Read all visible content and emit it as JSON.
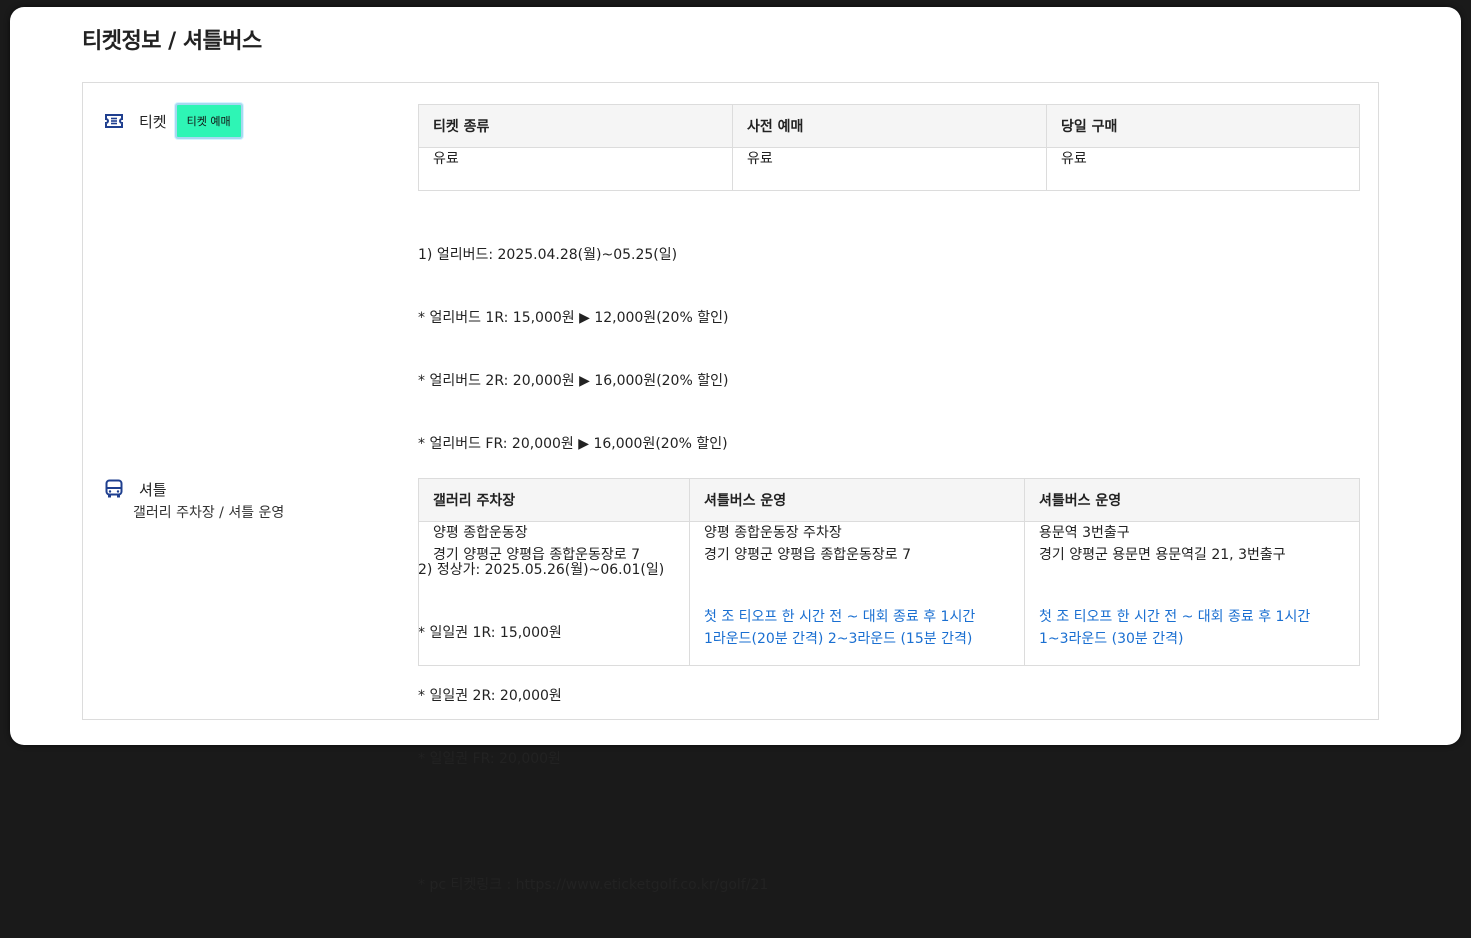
{
  "page": {
    "title": "티켓정보 / 셔틀버스"
  },
  "ticket": {
    "label": "티켓",
    "buy_button": "티켓 예매",
    "table": {
      "headers": [
        "티켓 종류",
        "사전 예매",
        "당일 구매"
      ],
      "row": [
        "유료",
        "유료",
        "유료"
      ]
    },
    "notes": [
      "1) 얼리버드: 2025.04.28(월)~05.25(일)",
      "* 얼리버드 1R: 15,000원 ▶ 12,000원(20% 할인)",
      "* 얼리버드 2R: 20,000원 ▶ 16,000원(20% 할인)",
      "* 얼리버드 FR: 20,000원 ▶ 16,000원(20% 할인)",
      "",
      "2) 정상가: 2025.05.26(월)~06.01(일)",
      "* 일일권 1R: 15,000원",
      "* 일일권 2R: 20,000원",
      "* 일일권 FR: 20,000원",
      "",
      "* pc 티켓링크 : https://www.eticketgolf.co.kr/golf/21"
    ]
  },
  "shuttle": {
    "label": "셔틀",
    "sublabel": "갤러리 주차장 / 셔틀 운영",
    "table": {
      "headers": [
        "갤러리 주차장",
        "셔틀버스 운영",
        "셔틀버스 운영"
      ],
      "cells": [
        {
          "line1": "양평 종합운동장",
          "line2": "경기 양평군 양평읍 종합운동장로 7",
          "note1": "",
          "note2": ""
        },
        {
          "line1": "양평 종합운동장 주차장",
          "line2": "경기 양평군 양평읍 종합운동장로 7",
          "note1": "첫 조 티오프 한 시간 전 ~ 대회 종료 후 1시간",
          "note2": "1라운드(20분 간격) 2~3라운드 (15분 간격)"
        },
        {
          "line1": "용문역 3번출구",
          "line2": "경기 양평군 용문면 용문역길 21, 3번출구",
          "note1": "첫 조 티오프 한 시간 전 ~ 대회 종료 후 1시간",
          "note2": "1~3라운드 (30분 간격)"
        }
      ]
    }
  },
  "colors": {
    "accent_button": "#2ef5b5",
    "link_blue": "#1a6fd1",
    "icon_blue": "#1f3f8f"
  },
  "icons": [
    "ticket-icon",
    "bus-icon"
  ]
}
